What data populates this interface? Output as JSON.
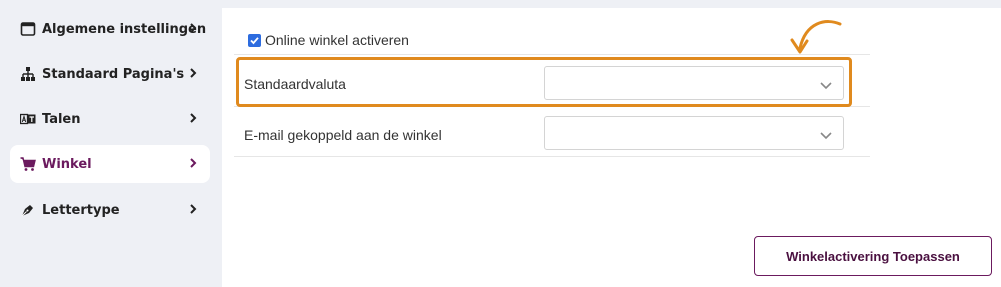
{
  "sidebar": {
    "items": [
      {
        "label": "Algemene instellingen",
        "icon": "window-icon"
      },
      {
        "label": "Standaard Pagina's",
        "icon": "sitemap-icon"
      },
      {
        "label": "Talen",
        "icon": "language-icon"
      },
      {
        "label": "Winkel",
        "icon": "cart-icon",
        "active": true
      },
      {
        "label": "Lettertype",
        "icon": "pen-icon"
      }
    ]
  },
  "main": {
    "online_shop_checkbox": {
      "label": "Online winkel activeren",
      "checked": true
    },
    "fields": [
      {
        "label": "Standaardvaluta",
        "value": ""
      },
      {
        "label": "E-mail gekoppeld aan de winkel",
        "value": ""
      }
    ],
    "apply_button": "Winkelactivering Toepassen"
  },
  "colors": {
    "accent": "#6b1a5e",
    "highlight": "#e08a1e",
    "checkbox": "#2d6cdf"
  }
}
